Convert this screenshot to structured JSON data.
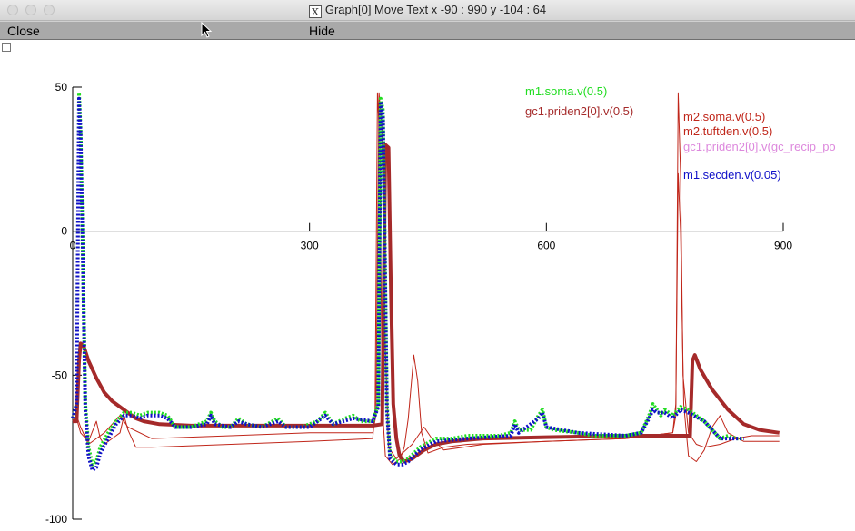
{
  "window": {
    "title": "Graph[0] Move Text x -90 : 990  y -104 : 64",
    "x_icon": "X"
  },
  "menu": {
    "close_label": "Close",
    "hide_label": "Hide"
  },
  "colors": {
    "green": "#22dd22",
    "brown": "#a52a2a",
    "red": "#c0261a",
    "pink": "#dd88dd",
    "blue": "#1010c8",
    "axis": "#000000"
  },
  "chart_data": {
    "type": "line",
    "title": "",
    "xlabel": "",
    "ylabel": "",
    "xlim": [
      0,
      900
    ],
    "ylim": [
      -100,
      50
    ],
    "x_ticks": [
      0,
      300,
      600,
      900
    ],
    "y_ticks": [
      50,
      0,
      -50,
      -100
    ],
    "grid": false,
    "legend_placement": "top-right",
    "series": [
      {
        "name": "m1.soma.v(0.5)",
        "color": "#22dd22",
        "style": "dotted-thick",
        "points": [
          [
            0,
            -65
          ],
          [
            5,
            -60
          ],
          [
            8,
            48
          ],
          [
            10,
            35
          ],
          [
            13,
            -10
          ],
          [
            16,
            -60
          ],
          [
            20,
            -75
          ],
          [
            25,
            -81
          ],
          [
            30,
            -80
          ],
          [
            35,
            -75
          ],
          [
            45,
            -70
          ],
          [
            55,
            -66
          ],
          [
            65,
            -63
          ],
          [
            75,
            -63
          ],
          [
            85,
            -64
          ],
          [
            95,
            -63
          ],
          [
            110,
            -63
          ],
          [
            120,
            -64
          ],
          [
            130,
            -68
          ],
          [
            140,
            -68
          ],
          [
            150,
            -68
          ],
          [
            160,
            -67
          ],
          [
            170,
            -66
          ],
          [
            175,
            -63
          ],
          [
            180,
            -66
          ],
          [
            190,
            -68
          ],
          [
            200,
            -68
          ],
          [
            210,
            -65
          ],
          [
            220,
            -67
          ],
          [
            240,
            -68
          ],
          [
            260,
            -65
          ],
          [
            270,
            -68
          ],
          [
            290,
            -68
          ],
          [
            310,
            -66
          ],
          [
            320,
            -63
          ],
          [
            330,
            -67
          ],
          [
            345,
            -65
          ],
          [
            355,
            -64
          ],
          [
            365,
            -66
          ],
          [
            380,
            -66
          ],
          [
            387,
            -60
          ],
          [
            390,
            46
          ],
          [
            393,
            42
          ],
          [
            396,
            -20
          ],
          [
            398,
            -60
          ],
          [
            402,
            -78
          ],
          [
            410,
            -80
          ],
          [
            418,
            -80
          ],
          [
            425,
            -79
          ],
          [
            440,
            -75
          ],
          [
            460,
            -72
          ],
          [
            480,
            -72
          ],
          [
            500,
            -71
          ],
          [
            520,
            -71
          ],
          [
            540,
            -71
          ],
          [
            555,
            -70
          ],
          [
            560,
            -66
          ],
          [
            565,
            -69
          ],
          [
            580,
            -69
          ],
          [
            590,
            -64
          ],
          [
            595,
            -62
          ],
          [
            600,
            -68
          ],
          [
            610,
            -69
          ],
          [
            640,
            -70
          ],
          [
            660,
            -71
          ],
          [
            680,
            -71
          ],
          [
            700,
            -71
          ],
          [
            720,
            -70
          ],
          [
            730,
            -64
          ],
          [
            735,
            -60
          ],
          [
            740,
            -62
          ],
          [
            745,
            -64
          ],
          [
            750,
            -62
          ],
          [
            760,
            -64
          ],
          [
            770,
            -61
          ],
          [
            780,
            -62
          ],
          [
            790,
            -64
          ],
          [
            800,
            -66
          ],
          [
            810,
            -69
          ],
          [
            820,
            -72
          ],
          [
            830,
            -71
          ],
          [
            840,
            -72
          ],
          [
            850,
            -72
          ]
        ]
      },
      {
        "name": "gc1.priden2[0].v(0.5)",
        "color": "#a52a2a",
        "style": "thick",
        "points": [
          [
            0,
            -66
          ],
          [
            5,
            -66
          ],
          [
            8,
            -45
          ],
          [
            10,
            -39
          ],
          [
            14,
            -40
          ],
          [
            20,
            -45
          ],
          [
            30,
            -51
          ],
          [
            40,
            -56
          ],
          [
            50,
            -59
          ],
          [
            60,
            -61
          ],
          [
            70,
            -63
          ],
          [
            80,
            -65
          ],
          [
            90,
            -66
          ],
          [
            110,
            -67
          ],
          [
            150,
            -67.5
          ],
          [
            200,
            -67.5
          ],
          [
            260,
            -67.5
          ],
          [
            320,
            -67.5
          ],
          [
            380,
            -67.5
          ],
          [
            392,
            -67
          ],
          [
            396,
            30
          ],
          [
            400,
            29
          ],
          [
            403,
            -20
          ],
          [
            406,
            -60
          ],
          [
            410,
            -72
          ],
          [
            414,
            -78
          ],
          [
            420,
            -80
          ],
          [
            430,
            -79
          ],
          [
            445,
            -76
          ],
          [
            460,
            -74
          ],
          [
            480,
            -73
          ],
          [
            520,
            -72
          ],
          [
            600,
            -71.5
          ],
          [
            700,
            -71
          ],
          [
            782,
            -71
          ],
          [
            785,
            -45
          ],
          [
            788,
            -43
          ],
          [
            795,
            -48
          ],
          [
            810,
            -55
          ],
          [
            830,
            -62
          ],
          [
            850,
            -67
          ],
          [
            870,
            -69
          ],
          [
            895,
            -70
          ]
        ]
      },
      {
        "name": "m2.soma.v(0.5)",
        "color": "#c0261a",
        "style": "thin",
        "points": [
          [
            0,
            -66
          ],
          [
            5,
            -65
          ],
          [
            10,
            -70
          ],
          [
            20,
            -73
          ],
          [
            30,
            -66
          ],
          [
            35,
            -72
          ],
          [
            40,
            -74
          ],
          [
            60,
            -70
          ],
          [
            65,
            -64
          ],
          [
            70,
            -69
          ],
          [
            80,
            -75
          ],
          [
            100,
            -75
          ],
          [
            200,
            -74
          ],
          [
            300,
            -73
          ],
          [
            380,
            -72
          ],
          [
            383,
            -62
          ],
          [
            386,
            48
          ],
          [
            389,
            30
          ],
          [
            392,
            -60
          ],
          [
            396,
            -78
          ],
          [
            405,
            -81
          ],
          [
            415,
            -79
          ],
          [
            420,
            -75
          ],
          [
            425,
            -65
          ],
          [
            432,
            -43
          ],
          [
            437,
            -52
          ],
          [
            442,
            -70
          ],
          [
            450,
            -77
          ],
          [
            470,
            -75
          ],
          [
            500,
            -74
          ],
          [
            600,
            -73
          ],
          [
            700,
            -72
          ],
          [
            760,
            -70
          ],
          [
            764,
            -64
          ],
          [
            767,
            48
          ],
          [
            770,
            20
          ],
          [
            773,
            -50
          ],
          [
            780,
            -70
          ],
          [
            790,
            -74
          ],
          [
            800,
            -75
          ],
          [
            820,
            -74
          ],
          [
            840,
            -72
          ],
          [
            860,
            -71
          ],
          [
            895,
            -71
          ]
        ]
      },
      {
        "name": "m2.tuftden.v(0.5)",
        "color": "#c0261a",
        "style": "thin",
        "points": [
          [
            0,
            -66
          ],
          [
            5,
            -64
          ],
          [
            10,
            -68
          ],
          [
            20,
            -74
          ],
          [
            40,
            -70
          ],
          [
            60,
            -64
          ],
          [
            70,
            -68
          ],
          [
            100,
            -72
          ],
          [
            200,
            -71
          ],
          [
            300,
            -70
          ],
          [
            380,
            -70
          ],
          [
            384,
            -64
          ],
          [
            388,
            48
          ],
          [
            392,
            35
          ],
          [
            396,
            -40
          ],
          [
            400,
            -75
          ],
          [
            410,
            -79
          ],
          [
            430,
            -74
          ],
          [
            445,
            -68
          ],
          [
            455,
            -72
          ],
          [
            470,
            -76
          ],
          [
            520,
            -74
          ],
          [
            600,
            -73
          ],
          [
            700,
            -72
          ],
          [
            760,
            -70
          ],
          [
            764,
            -60
          ],
          [
            767,
            20
          ],
          [
            770,
            0
          ],
          [
            774,
            -60
          ],
          [
            780,
            -78
          ],
          [
            790,
            -80
          ],
          [
            800,
            -76
          ],
          [
            810,
            -68
          ],
          [
            820,
            -64
          ],
          [
            830,
            -70
          ],
          [
            850,
            -73
          ],
          [
            895,
            -73
          ]
        ]
      },
      {
        "name": "gc1.priden2[0].v(gc_recip_po",
        "color": "#dd88dd",
        "style": "thin",
        "points": []
      },
      {
        "name": "m1.secden.v(0.05)",
        "color": "#1010c8",
        "style": "dotted-thick",
        "points": [
          [
            0,
            -65
          ],
          [
            5,
            -60
          ],
          [
            8,
            46
          ],
          [
            10,
            34
          ],
          [
            13,
            -12
          ],
          [
            16,
            -62
          ],
          [
            20,
            -78
          ],
          [
            25,
            -83
          ],
          [
            30,
            -82
          ],
          [
            35,
            -77
          ],
          [
            45,
            -72
          ],
          [
            55,
            -67
          ],
          [
            65,
            -64
          ],
          [
            75,
            -64
          ],
          [
            85,
            -65
          ],
          [
            95,
            -64
          ],
          [
            110,
            -64
          ],
          [
            120,
            -65
          ],
          [
            130,
            -68
          ],
          [
            150,
            -68
          ],
          [
            170,
            -67
          ],
          [
            175,
            -64
          ],
          [
            180,
            -67
          ],
          [
            200,
            -68
          ],
          [
            210,
            -66
          ],
          [
            220,
            -67
          ],
          [
            240,
            -68
          ],
          [
            260,
            -66
          ],
          [
            270,
            -68
          ],
          [
            300,
            -68
          ],
          [
            320,
            -64
          ],
          [
            330,
            -67
          ],
          [
            355,
            -65
          ],
          [
            380,
            -66
          ],
          [
            387,
            -61
          ],
          [
            390,
            45
          ],
          [
            393,
            40
          ],
          [
            396,
            -22
          ],
          [
            398,
            -62
          ],
          [
            402,
            -79
          ],
          [
            410,
            -81
          ],
          [
            418,
            -81
          ],
          [
            425,
            -80
          ],
          [
            440,
            -76
          ],
          [
            460,
            -73
          ],
          [
            500,
            -72
          ],
          [
            555,
            -71
          ],
          [
            560,
            -67
          ],
          [
            565,
            -70
          ],
          [
            590,
            -65
          ],
          [
            595,
            -63
          ],
          [
            600,
            -68
          ],
          [
            640,
            -70
          ],
          [
            700,
            -71
          ],
          [
            720,
            -70
          ],
          [
            730,
            -65
          ],
          [
            735,
            -62
          ],
          [
            740,
            -63
          ],
          [
            750,
            -63
          ],
          [
            760,
            -65
          ],
          [
            770,
            -62
          ],
          [
            780,
            -63
          ],
          [
            800,
            -66
          ],
          [
            820,
            -72
          ],
          [
            850,
            -72
          ]
        ]
      }
    ]
  }
}
